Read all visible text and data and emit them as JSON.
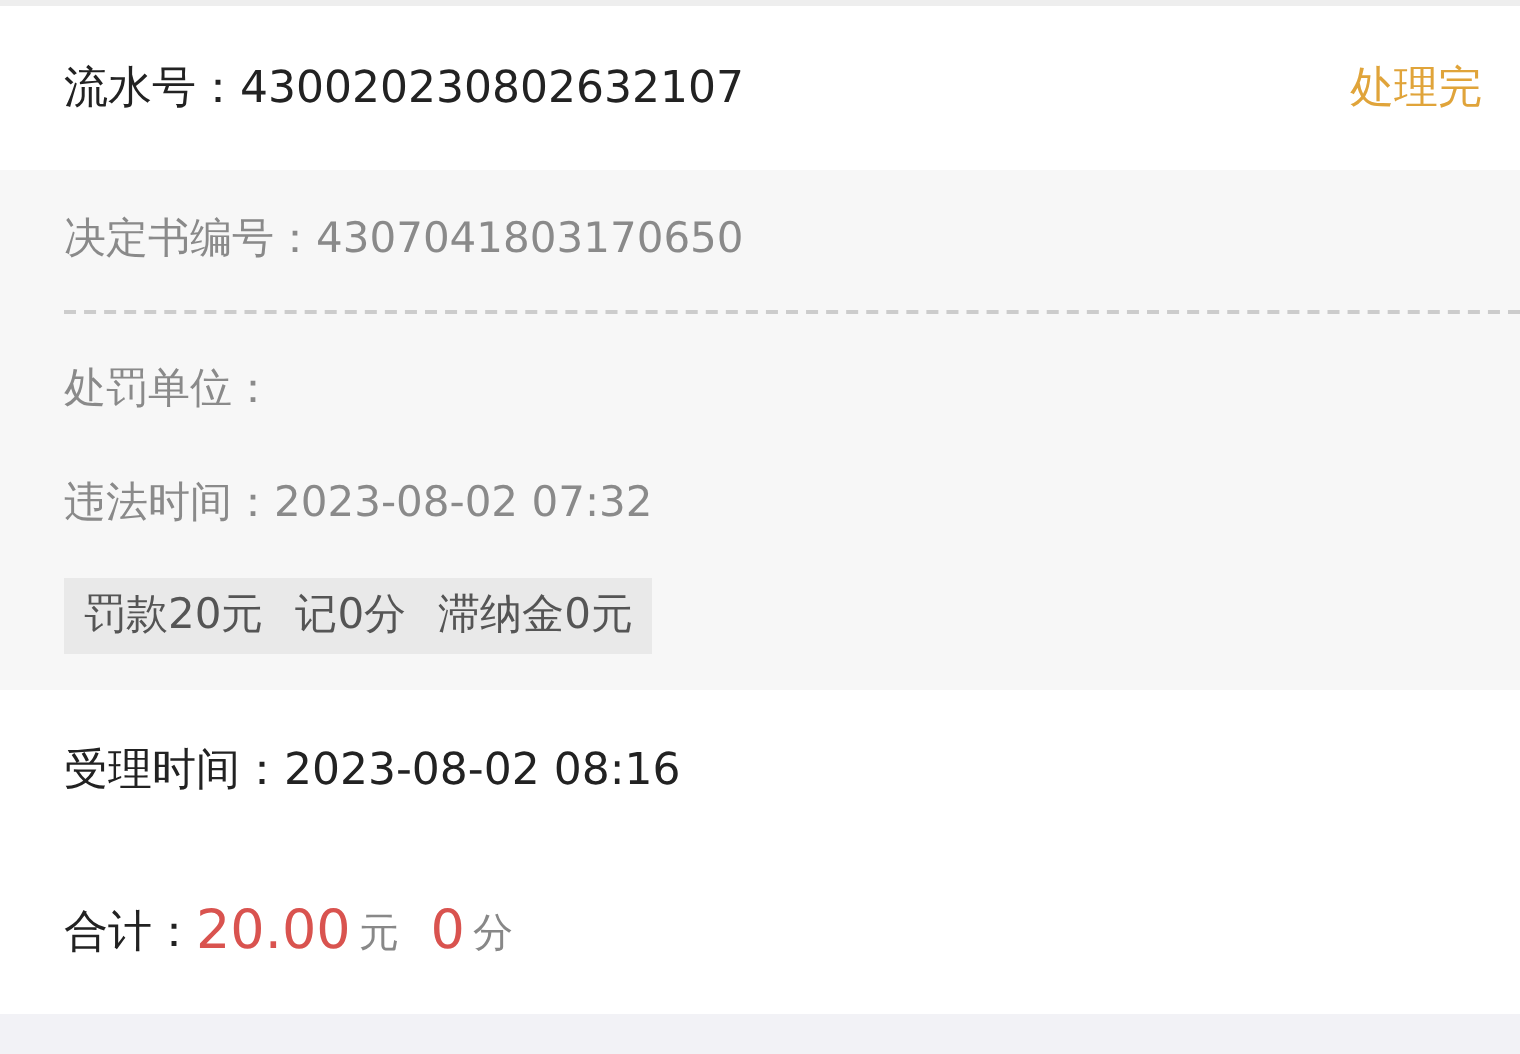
{
  "record": {
    "serial_label": "流水号：",
    "serial": "430020230802632107",
    "status": "处理完"
  },
  "details": {
    "decision_label": "决定书编号：",
    "decision_no": "4307041803170650",
    "unit_label": "处罚单位：",
    "time_label": "违法时间：",
    "time": "2023-08-02 07:32",
    "penalties": [
      "罚款20元",
      "记0分",
      "滞纳金0元"
    ]
  },
  "accepted": {
    "label": "受理时间：",
    "time": "2023-08-02 08:16"
  },
  "total": {
    "label": "合计：",
    "amount": "20.00",
    "amount_unit": "元",
    "points": "0",
    "points_unit": "分"
  }
}
